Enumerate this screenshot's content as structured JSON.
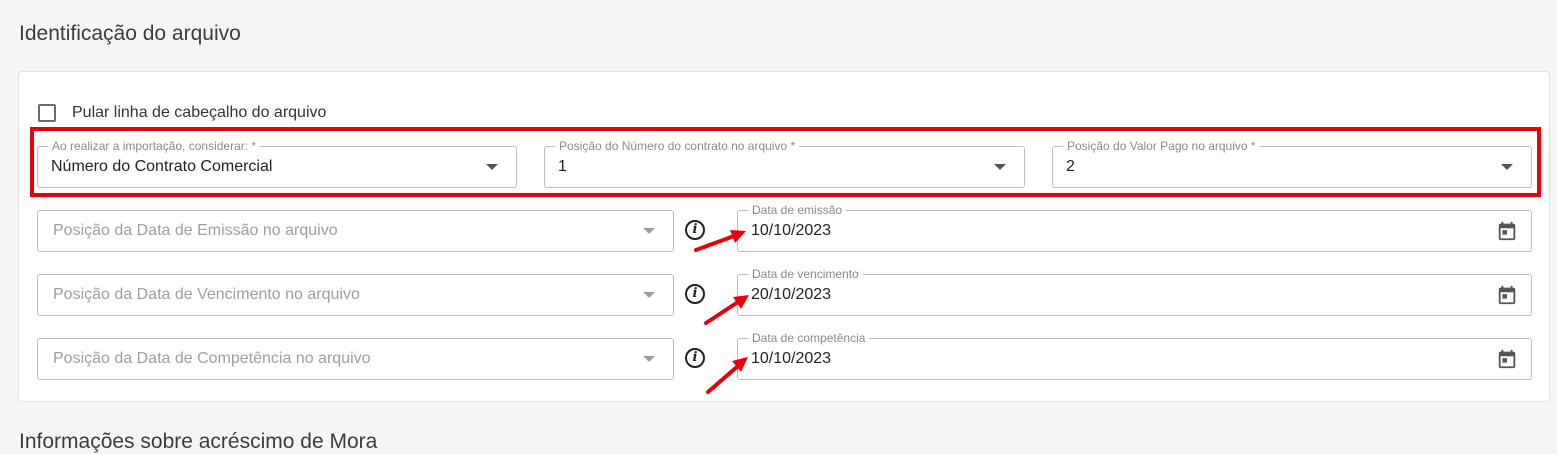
{
  "section": {
    "title": "Identificação do arquivo",
    "next_title": "Informações sobre acréscimo de Mora"
  },
  "skip_header": {
    "label": "Pular linha de cabeçalho do arquivo",
    "checked": false
  },
  "import_config": {
    "consider": {
      "label": "Ao realizar a importação, considerar: *",
      "value": "Número do Contrato Comercial"
    },
    "contract_position": {
      "label": "Posição do Número do contrato no arquivo *",
      "value": "1"
    },
    "paid_value_position": {
      "label": "Posição do Valor Pago no arquivo *",
      "value": "2"
    }
  },
  "date_rows": [
    {
      "position_placeholder": "Posição da Data de Emissão no arquivo",
      "date_label": "Data de emissão",
      "date_value": "10/10/2023"
    },
    {
      "position_placeholder": "Posição da Data de Vencimento no arquivo",
      "date_label": "Data de vencimento",
      "date_value": "20/10/2023"
    },
    {
      "position_placeholder": "Posição da Data de Competência no arquivo",
      "date_label": "Data de competência",
      "date_value": "10/10/2023"
    }
  ],
  "icons": {
    "info": "i",
    "calendar": "calendar-icon",
    "dropdown": "chevron-down-icon"
  },
  "colors": {
    "highlight": "#e8000b",
    "annotation_arrow": "#e8000b"
  }
}
